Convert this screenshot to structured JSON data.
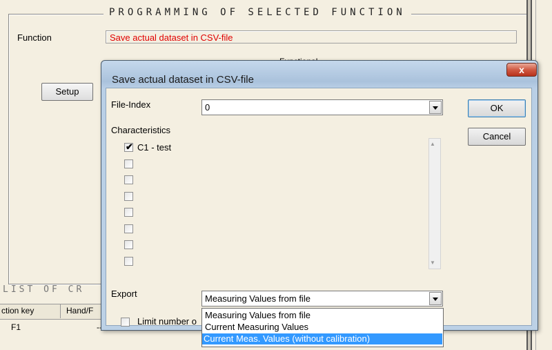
{
  "background": {
    "group_title": "PROGRAMMING OF SELECTED FUNCTION",
    "function_label": "Function",
    "function_value": "Save actual dataset in CSV-file",
    "functional_fragment": "Functional",
    "setup_label": "Setup",
    "list_title": "LIST OF CR",
    "columns": [
      "ction key",
      "Hand/F"
    ],
    "row": {
      "key": "F1",
      "hand": "--"
    }
  },
  "dialog": {
    "title": "Save actual dataset in CSV-file",
    "close_glyph": "x",
    "file_index_label": "File-Index",
    "file_index_value": "0",
    "ok_label": "OK",
    "cancel_label": "Cancel",
    "characteristics_label": "Characteristics",
    "characteristics": [
      {
        "label": "C1 - test",
        "checked": true
      },
      {
        "label": "",
        "checked": false
      },
      {
        "label": "",
        "checked": false
      },
      {
        "label": "",
        "checked": false
      },
      {
        "label": "",
        "checked": false
      },
      {
        "label": "",
        "checked": false
      },
      {
        "label": "",
        "checked": false
      },
      {
        "label": "",
        "checked": false
      }
    ],
    "export_label": "Export",
    "export_value": "Measuring Values from file",
    "export_options": [
      "Measuring Values from file",
      "Current Measuring Values",
      "Current Meas. Values (without calibration)"
    ],
    "export_highlighted_index": 2,
    "limit_label": "Limit number o"
  },
  "colors": {
    "window_bg": "#f4efe1",
    "function_text": "#e00000",
    "selection": "#3399ff",
    "close_button": "#c8452e"
  },
  "icons": {
    "dropdown": "chevron-down-icon",
    "close": "close-icon",
    "check": "checkmark-icon"
  }
}
